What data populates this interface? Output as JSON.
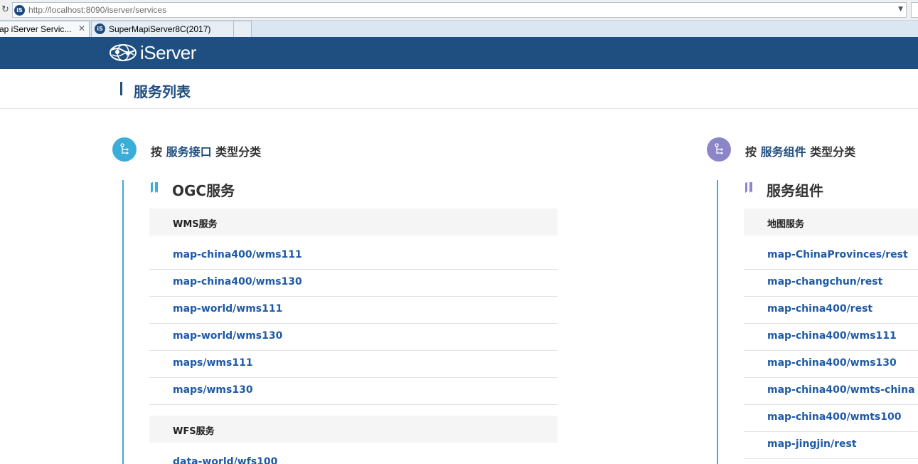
{
  "browser": {
    "url": "http://localhost:8090/iserver/services",
    "tabs": [
      {
        "label": "ap iServer Servic..."
      },
      {
        "label": "SuperMapiServer8C(2017)"
      }
    ]
  },
  "header": {
    "logo_text": "iServer",
    "brand_color": "#1f4e80"
  },
  "page": {
    "title": "服务列表"
  },
  "left_column": {
    "heading_prefix": "按 ",
    "heading_keyword": "服务接口",
    "heading_suffix": " 类型分类",
    "section_title": "OGC服务",
    "groups": [
      {
        "name": "WMS服务",
        "links": [
          "map-china400/wms111",
          "map-china400/wms130",
          "map-world/wms111",
          "map-world/wms130",
          "maps/wms111",
          "maps/wms130"
        ]
      },
      {
        "name": "WFS服务",
        "links": [
          "data-world/wfs100"
        ]
      }
    ]
  },
  "right_column": {
    "heading_prefix": "按 ",
    "heading_keyword": "服务组件",
    "heading_suffix": " 类型分类",
    "section_title": "服务组件",
    "groups": [
      {
        "name": "地图服务",
        "links": [
          "map-ChinaProvinces/rest",
          "map-changchun/rest",
          "map-china400/rest",
          "map-china400/wms111",
          "map-china400/wms130",
          "map-china400/wmts-china",
          "map-china400/wmts100",
          "map-jingjin/rest"
        ]
      }
    ]
  },
  "colors": {
    "left_accent": "#3aaed8",
    "right_accent": "#8c86c9",
    "link": "#1f5aa6"
  }
}
